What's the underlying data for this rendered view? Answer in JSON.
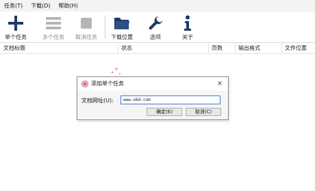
{
  "menu": [
    "任务(T)",
    "下载(D)",
    "帮助(H)"
  ],
  "toolbar": {
    "add_single": "单个任务",
    "add_multi": "多个任务",
    "cancel": "取消任务",
    "download_location": "下载位置",
    "options": "选项",
    "about": "关于"
  },
  "columns": [
    "文档标题",
    "状态",
    "页数",
    "输出格式",
    "文件位置"
  ],
  "dialog": {
    "title": "添加单个任务",
    "close_glyph": "×",
    "url_label": "文档网址(U):",
    "url_value": "www.x6d.com",
    "ok": "确定(E)",
    "cancel": "取消(C)"
  },
  "colors": {
    "accent_dark": "#1f3a63",
    "disabled_icon": "#b5b5b5",
    "folder": "#1f3a63"
  }
}
